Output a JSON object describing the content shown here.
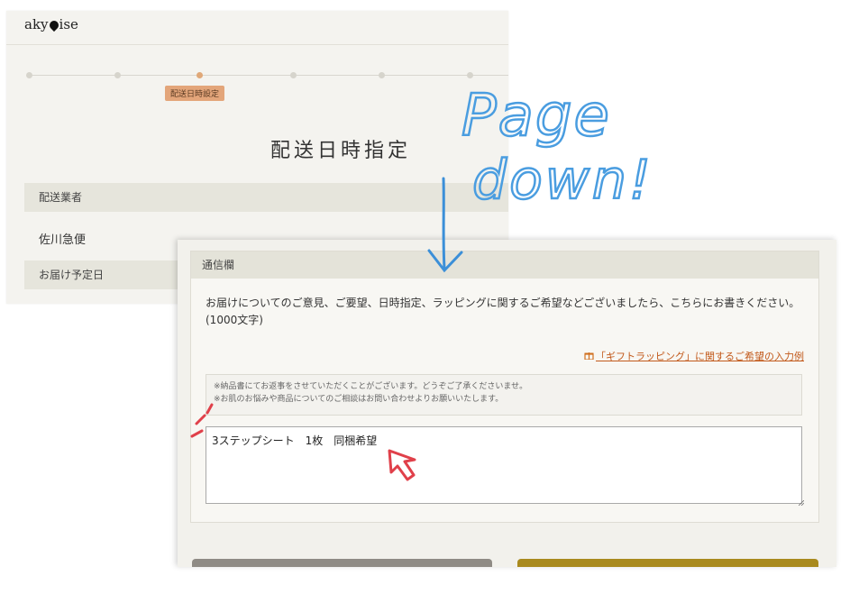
{
  "top_screenshot": {
    "logo": {
      "text_left": "aky",
      "text_right": "ise"
    },
    "step_label": "配送日時設定",
    "page_title": "配送日時指定",
    "sections": [
      {
        "label": "配送業者",
        "value": "佐川急便"
      },
      {
        "label": "お届け予定日"
      }
    ]
  },
  "annotation": {
    "handwritten_text": [
      "Page",
      "down!"
    ],
    "arrow_color": "#3b8fd8",
    "cursor_color": "#e0404a"
  },
  "bottom_screenshot": {
    "section_label": "通信欄",
    "description": "お届けについてのご意見、ご要望、日時指定、ラッピングに関するご希望などございましたら、こちらにお書きください。(1000文字)",
    "gift_link": "「ギフトラッピング」に関するご希望の入力例",
    "notes": [
      "※納品書にてお返事をさせていただくことがございます。どうぞご了承くださいませ。",
      "※お肌のお悩みや商品についてのご相談はお問い合わせよりお願いいたします。"
    ],
    "message_value": "3ステップシート　1枚　同梱希望"
  }
}
